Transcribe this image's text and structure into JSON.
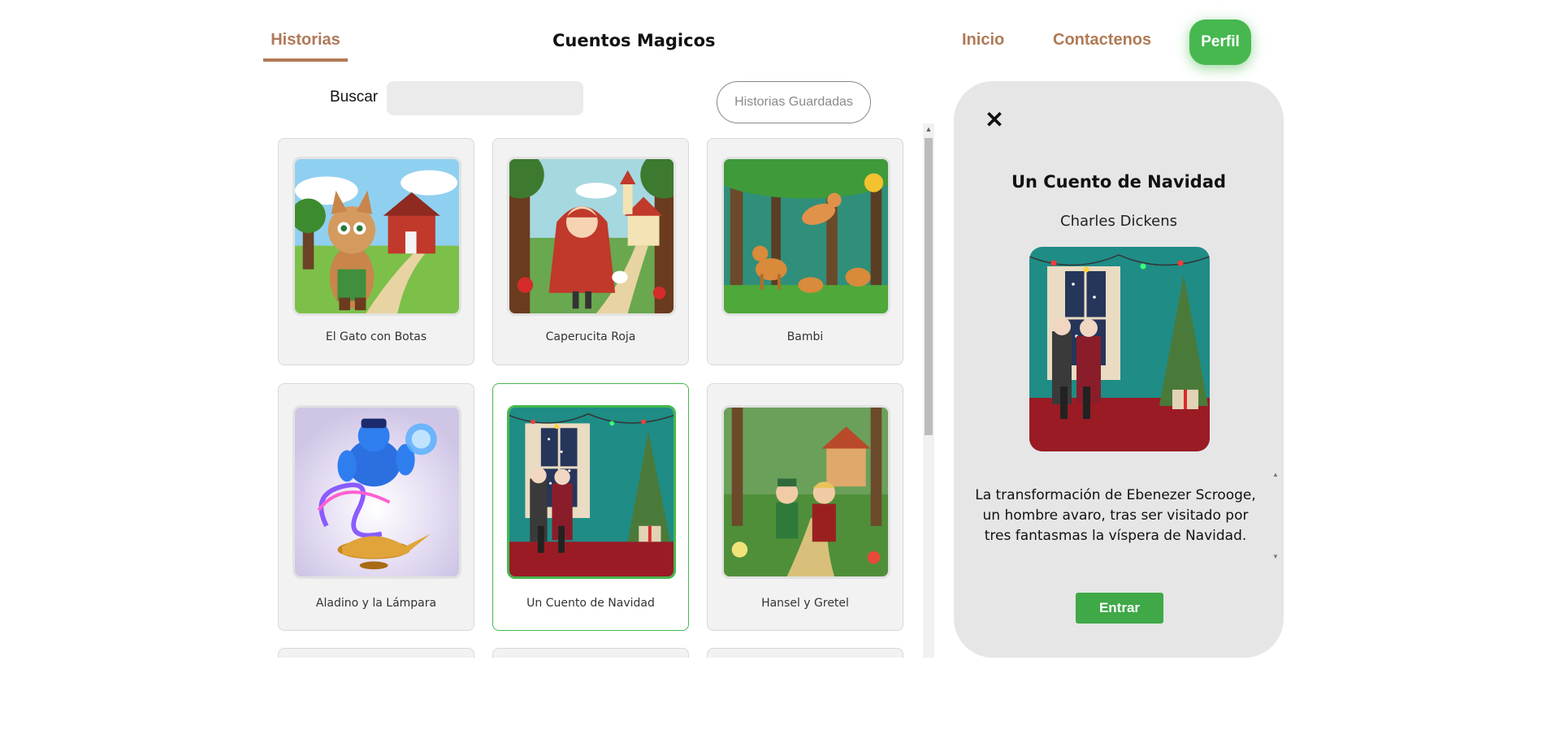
{
  "header": {
    "active_tab": "Historias",
    "app_title": "Cuentos Magicos",
    "nav": {
      "inicio": "Inicio",
      "contactenos": "Contactenos",
      "perfil": "Perfil"
    }
  },
  "search": {
    "label": "Buscar",
    "value": "",
    "placeholder": "",
    "saved_button": "Historias Guardadas"
  },
  "stories": [
    {
      "title": "El Gato con Botas",
      "icon": "cat-in-boots-illustration"
    },
    {
      "title": "Caperucita Roja",
      "icon": "little-red-riding-hood-illustration"
    },
    {
      "title": "Bambi",
      "icon": "deer-forest-illustration"
    },
    {
      "title": "Aladino y la Lámpara",
      "icon": "genie-lamp-illustration"
    },
    {
      "title": "Un Cuento de Navidad",
      "icon": "christmas-carol-illustration",
      "selected": true
    },
    {
      "title": "Hansel y Gretel",
      "icon": "hansel-gretel-illustration"
    }
  ],
  "detail": {
    "title": "Un Cuento de Navidad",
    "author": "Charles Dickens",
    "description": "La transformación de Ebenezer Scrooge, un hombre avaro, tras ser visitado por tres fantasmas la víspera de Navidad.",
    "enter_button": "Entrar",
    "close_icon": "close-icon"
  },
  "colors": {
    "accent_brown": "#b07a55",
    "accent_green": "#46b84f",
    "panel_bg": "#e6e6e6"
  }
}
